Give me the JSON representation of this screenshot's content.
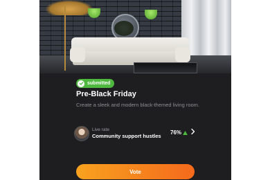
{
  "status_badge": {
    "label": "submitted",
    "color": "#4fb83f",
    "icon": "check-icon"
  },
  "challenge": {
    "title": "Pre-Black Friday",
    "description": "Create a sleek and modern black-themed living room."
  },
  "live_rate": {
    "label": "Live rate",
    "name": "Community support hustles",
    "percent": "76%",
    "trend_icon": "triangle-up-icon",
    "trend_color": "#4fb83f",
    "chevron_icon": "chevron-right-icon"
  },
  "vote_button": {
    "label": "Vote",
    "gradient": [
      "#f8a21f",
      "#f46a1c"
    ]
  },
  "colors": {
    "card_bg": "#1e1e20",
    "muted_text": "#8d8f94"
  }
}
